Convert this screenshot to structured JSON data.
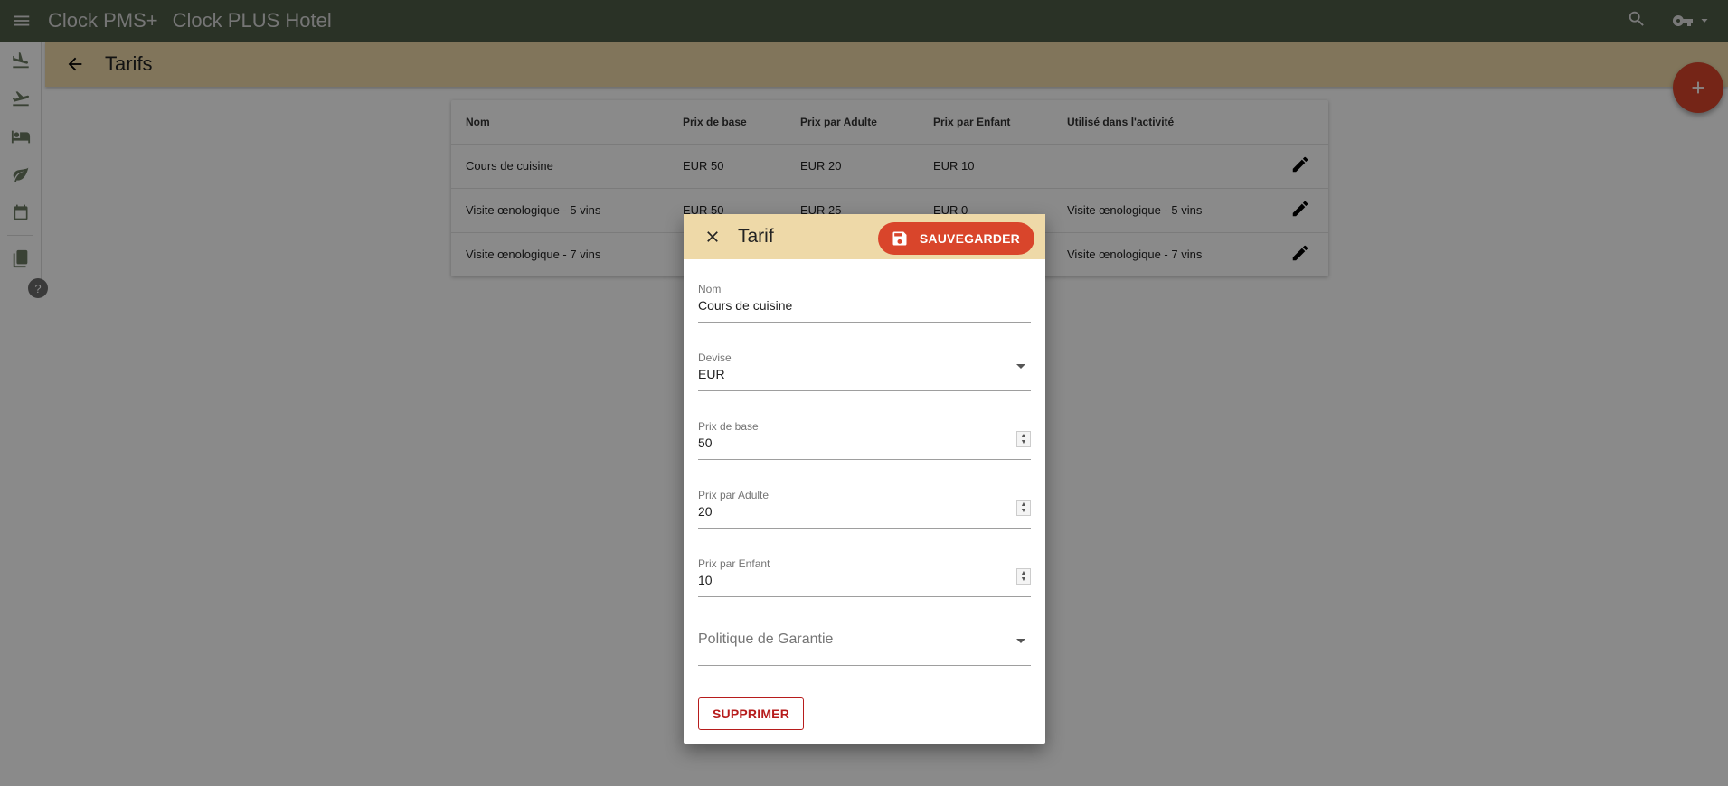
{
  "app": {
    "title": "Clock PMS+",
    "hotel": "Clock PLUS Hotel",
    "icons": [
      "menu-icon",
      "search-icon",
      "key-icon",
      "caret-down-icon"
    ]
  },
  "rail": {
    "items": [
      "arrivals-icon",
      "departures-icon",
      "bed-icon",
      "leaf-icon",
      "calendar-icon",
      "book-icon"
    ],
    "help_label": "?"
  },
  "page": {
    "title": "Tarifs"
  },
  "table": {
    "headers": [
      "Nom",
      "Prix de base",
      "Prix par Adulte",
      "Prix par Enfant",
      "Utilisé dans l'activité"
    ],
    "rows": [
      {
        "nom": "Cours de cuisine",
        "base": "EUR 50",
        "adulte": "EUR 20",
        "enfant": "EUR 10",
        "activite": ""
      },
      {
        "nom": "Visite œnologique - 5 vins",
        "base": "EUR 50",
        "adulte": "EUR 25",
        "enfant": "EUR 0",
        "activite": "Visite œnologique - 5 vins"
      },
      {
        "nom": "Visite œnologique - 7 vins",
        "base": "",
        "adulte": "",
        "enfant": "",
        "activite": "Visite œnologique - 7 vins"
      }
    ]
  },
  "dialog": {
    "title": "Tarif",
    "save_label": "SAUVEGARDER",
    "delete_label": "SUPPRIMER",
    "fields": {
      "nom": {
        "label": "Nom",
        "value": "Cours de cuisine"
      },
      "devise": {
        "label": "Devise",
        "value": "EUR"
      },
      "base": {
        "label": "Prix de base",
        "value": "50"
      },
      "adulte": {
        "label": "Prix par Adulte",
        "value": "20"
      },
      "enfant": {
        "label": "Prix par Enfant",
        "value": "10"
      },
      "garantie": {
        "placeholder": "Politique de Garantie"
      }
    }
  },
  "colors": {
    "appbar": "#4f5d47",
    "header": "#eed9a8",
    "accent": "#d9452b",
    "danger": "#b71c1c"
  }
}
